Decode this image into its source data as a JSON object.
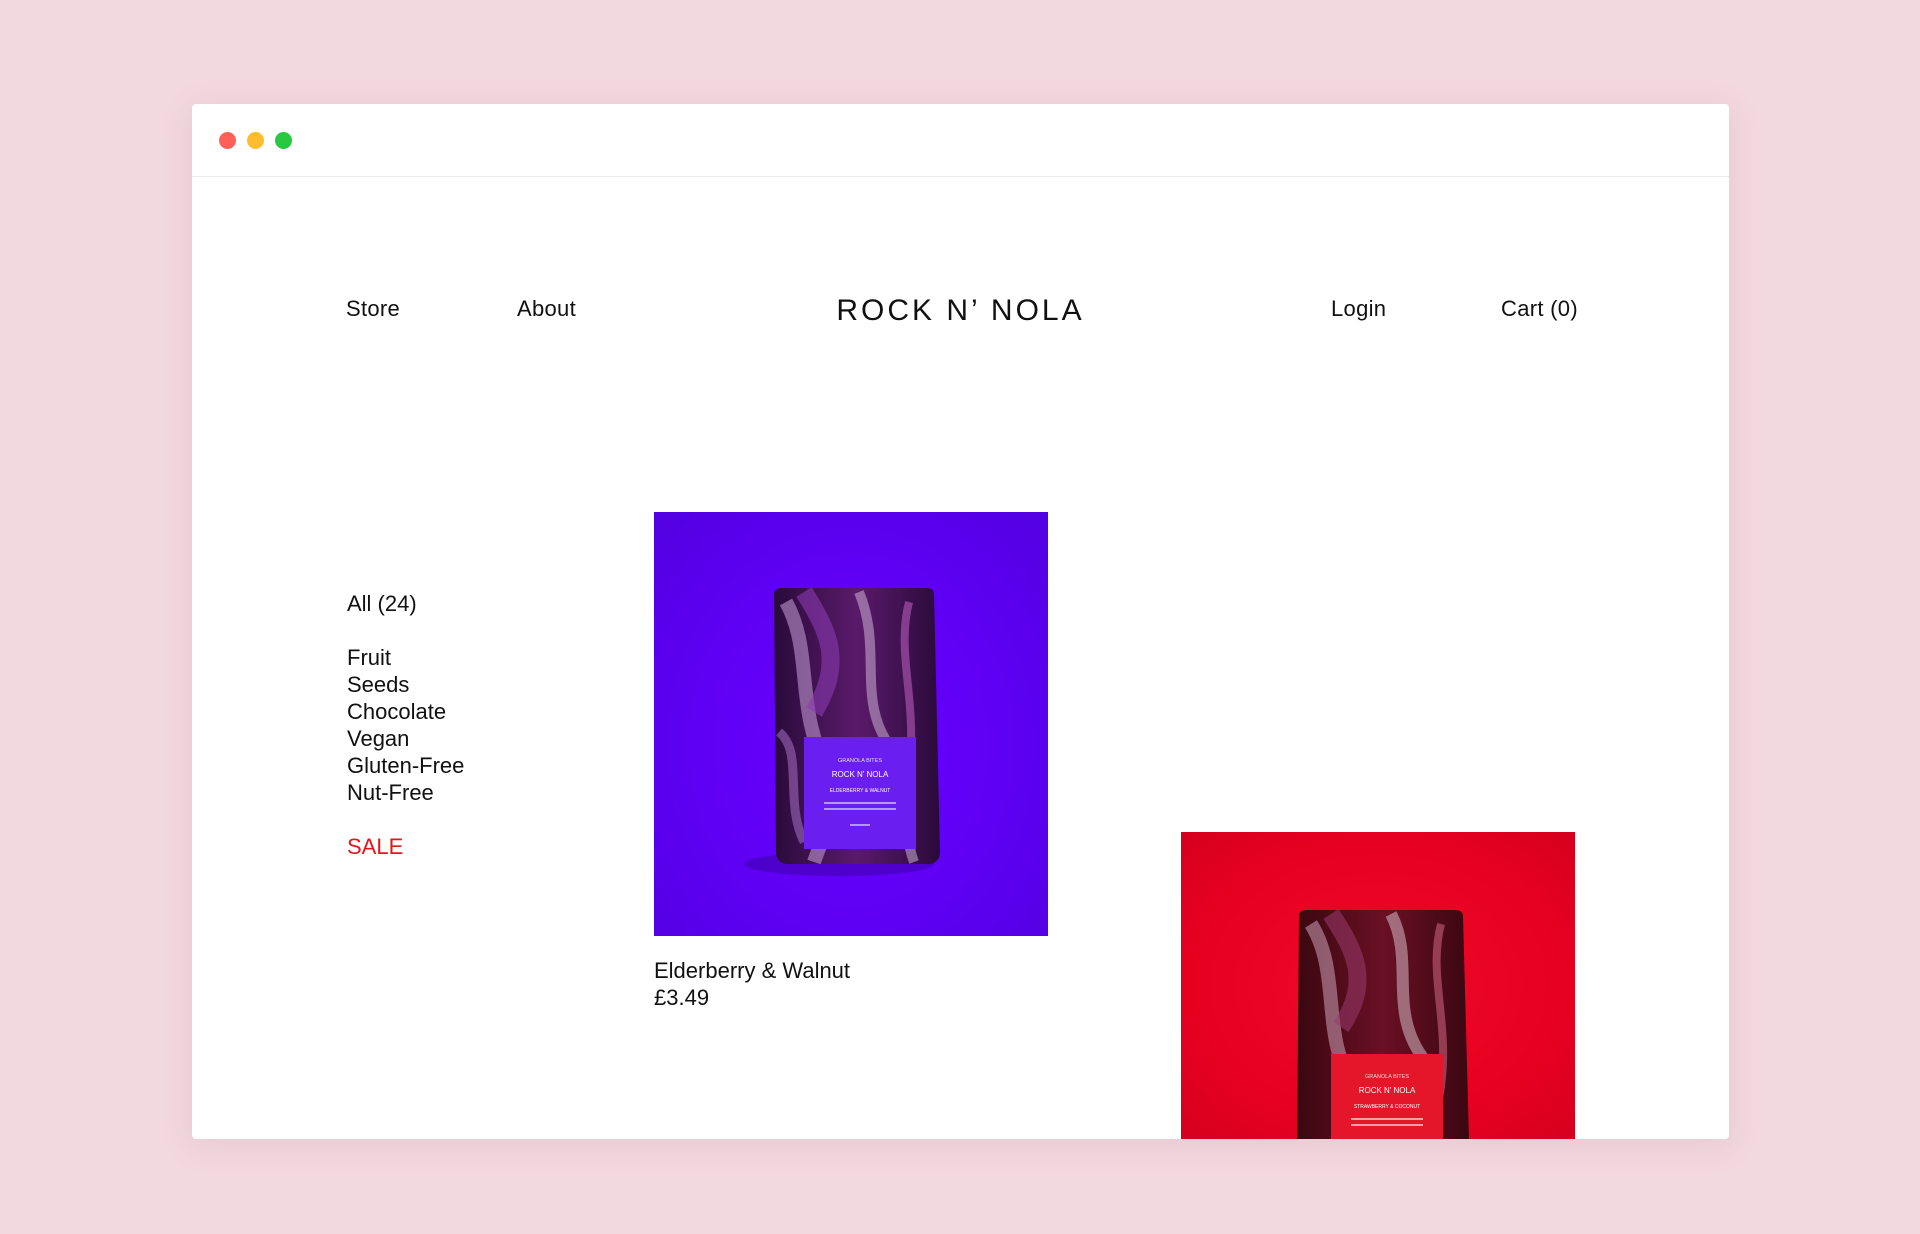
{
  "nav": {
    "left": [
      "Store",
      "About"
    ],
    "brand": "ROCK N’ NOLA",
    "right": [
      "Login",
      "Cart (0)"
    ]
  },
  "filters": {
    "all": "All (24)",
    "categories": [
      "Fruit",
      "Seeds",
      "Chocolate",
      "Vegan",
      "Gluten-Free",
      "Nut-Free"
    ],
    "sale": "SALE"
  },
  "products": [
    {
      "name": "Elderberry & Walnut",
      "price": "£3.49",
      "background": "#5d00f2",
      "pack": {
        "top_line": "GRANOLA BITES",
        "brand": "ROCK N’ NOLA",
        "flavour": "ELDERBERRY & WALNUT",
        "label_color": "#6a1ff0"
      }
    },
    {
      "background": "#e50020",
      "pack": {
        "top_line": "GRANOLA BITES",
        "brand": "ROCK N’ NOLA",
        "flavour": "STRAWBERRY & COCONUT",
        "label_color": "#e5162a"
      }
    }
  ],
  "window_controls": {
    "close_color": "#fe5f57",
    "minimize_color": "#febc2e",
    "maximize_color": "#28c840"
  }
}
